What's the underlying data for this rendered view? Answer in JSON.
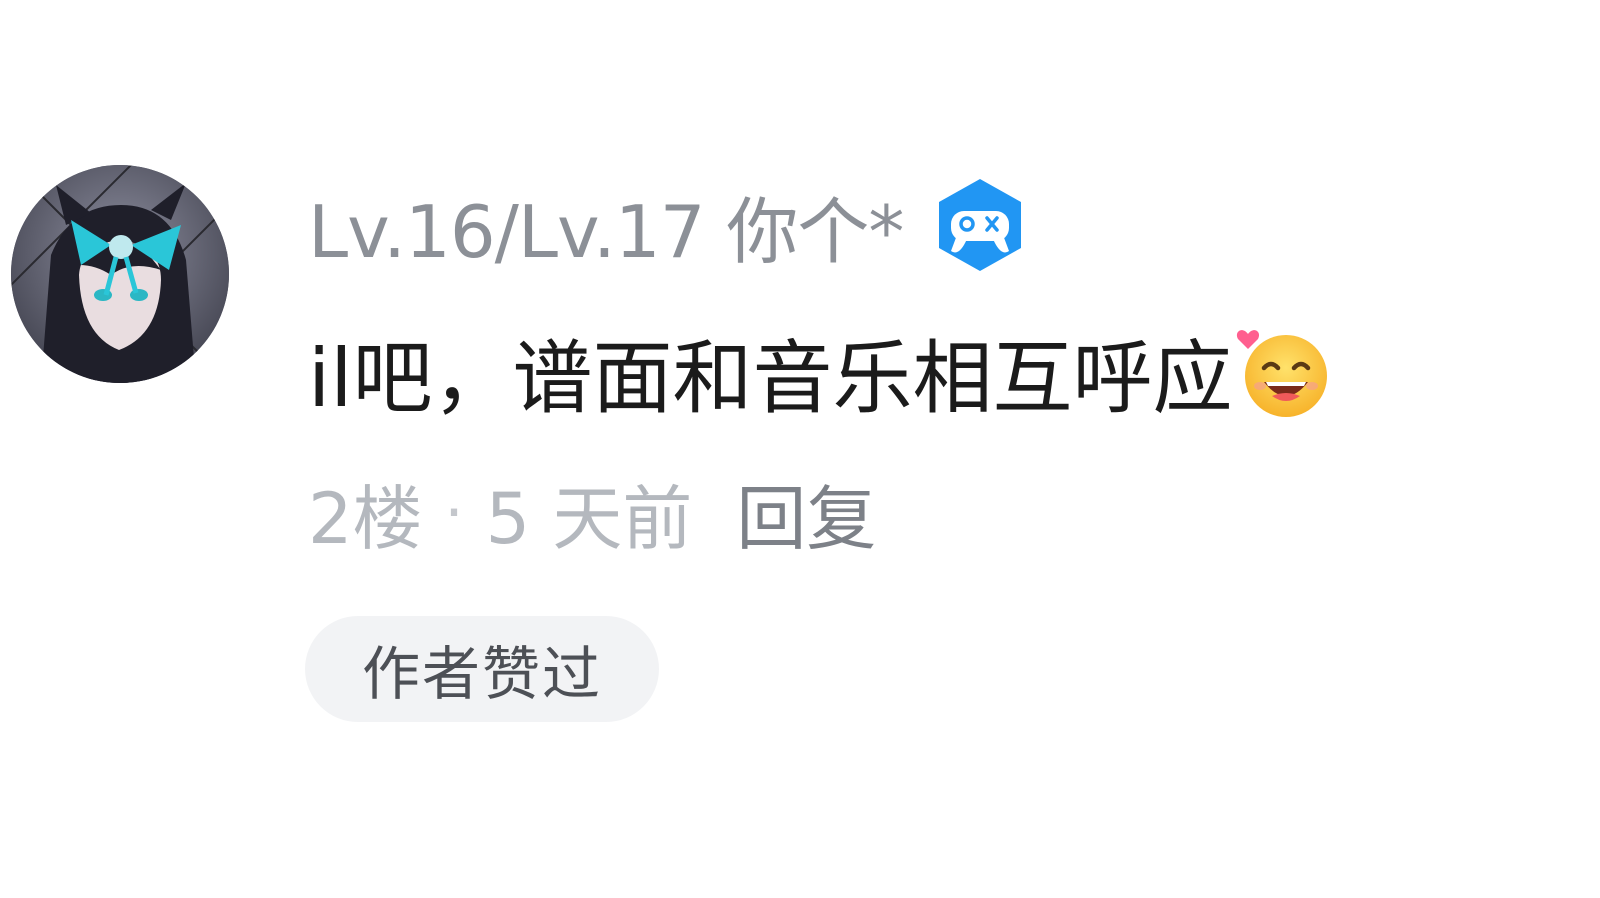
{
  "comment": {
    "username": "Lv.16/Lv.17 你个*",
    "badge_icon": "gamepad-badge-icon",
    "badge_color": "#2196f3",
    "text": "il吧，谱面和音乐相互呼应",
    "emoji_icon": "smiling-face-with-heart-emoji-icon",
    "floor": "2楼",
    "separator": "·",
    "time": "5 天前",
    "reply_label": "回复",
    "liked_tag": "作者赞过"
  }
}
